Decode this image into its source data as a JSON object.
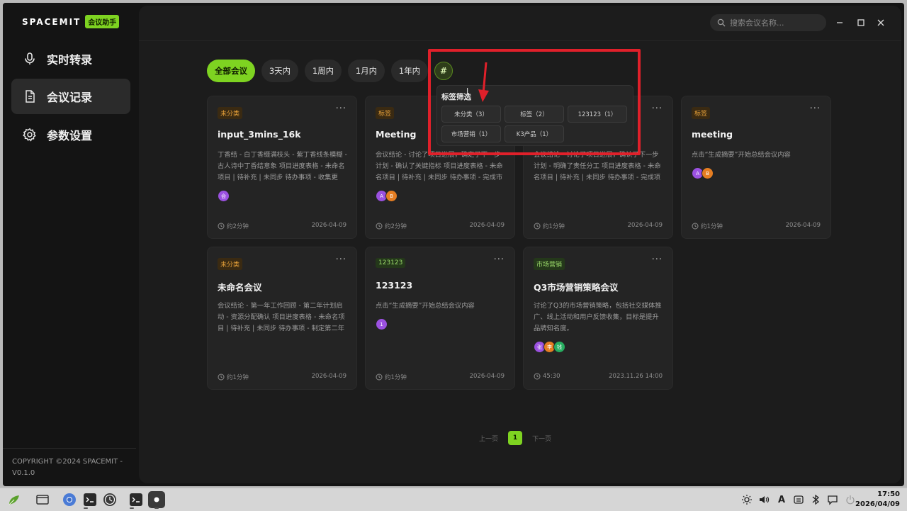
{
  "app": {
    "brand": "SPACEMIT",
    "badge": "会议助手"
  },
  "sidebar": {
    "items": [
      {
        "label": "实时转录",
        "icon": "microphone-icon"
      },
      {
        "label": "会议记录",
        "icon": "document-icon"
      },
      {
        "label": "参数设置",
        "icon": "gear-icon"
      }
    ],
    "copyright": "COPYRIGHT ©2024 SPACEMIT - V0.1.0"
  },
  "search": {
    "placeholder": "搜索会议名称..."
  },
  "filters": [
    "全部会议",
    "3天内",
    "1周内",
    "1月内",
    "1年内",
    "#"
  ],
  "popover": {
    "title": "标签筛选",
    "tags": [
      "未分类（3）",
      "标签（2）",
      "123123（1）",
      "市场营销（1）",
      "K3产品（1）"
    ]
  },
  "cards": [
    {
      "tag": "未分类",
      "title": "input_3mins_16k",
      "summary": "丁香结 - 白丁香缀满枝头 - 紫丁香线条模糊 - 古人诗中丁香结意象 项目进度表格 - 未命名项目 | 待补充 | 未同步 待办事项 - 收集更多…",
      "avatars": [
        "会"
      ],
      "duration": "约2分钟",
      "date": "2026-04-09"
    },
    {
      "tag": "标签",
      "title": "Meeting",
      "summary": "会议结论 - 讨论了项目进展，确定了下一步计划 - 确认了关键指标 项目进度表格 - 未命名项目 | 待补充 | 未同步 待办事项 - 完成市场调…",
      "avatars": [
        "A",
        "B"
      ],
      "duration": "约2分钟",
      "date": "2026-04-09"
    },
    {
      "tag": "",
      "title": "",
      "summary": "会议结论 - 讨论了项目进展，确认了下一步计划 - 明确了责任分工 项目进度表格 - 未命名项目 | 待补充 | 未同步 待办事项 - 完成项目进…",
      "avatars": [],
      "duration": "约1分钟",
      "date": "2026-04-09"
    },
    {
      "tag": "标签",
      "title": "meeting",
      "summary": "点击“生成摘要”开始总结会议内容",
      "avatars": [
        "A",
        "B"
      ],
      "duration": "约1分钟",
      "date": "2026-04-09"
    },
    {
      "tag": "未分类",
      "title": "未命名会议",
      "summary": "会议结论 - 第一年工作回顾 - 第二年计划启动 - 资源分配确认 项目进度表格 - 未命名项目 | 待补充 | 未同步 待办事项 - 制定第二年工作…",
      "avatars": [],
      "duration": "约1分钟",
      "date": "2026-04-09"
    },
    {
      "tag": "123123",
      "title": "123123",
      "summary": "点击“生成摘要”开始总结会议内容",
      "avatars": [
        "1"
      ],
      "duration": "约1分钟",
      "date": "2026-04-09"
    },
    {
      "tag": "市场营销",
      "title": "Q3市场营销策略会议",
      "summary": "讨论了Q3的市场营销策略，包括社交媒体推广、线上活动和用户反馈收集，目标是提升品牌知名度。",
      "avatars": [
        "张",
        "李",
        "钱"
      ],
      "duration": "45:30",
      "date": "2023.11.26 14:00"
    }
  ],
  "pager": {
    "prev": "上一页",
    "current": "1",
    "next": "下一页"
  },
  "clock": {
    "time": "17:50",
    "date": "2026/04/09"
  },
  "colors": {
    "accent": "#7ed321",
    "annotation": "#e0202a"
  }
}
